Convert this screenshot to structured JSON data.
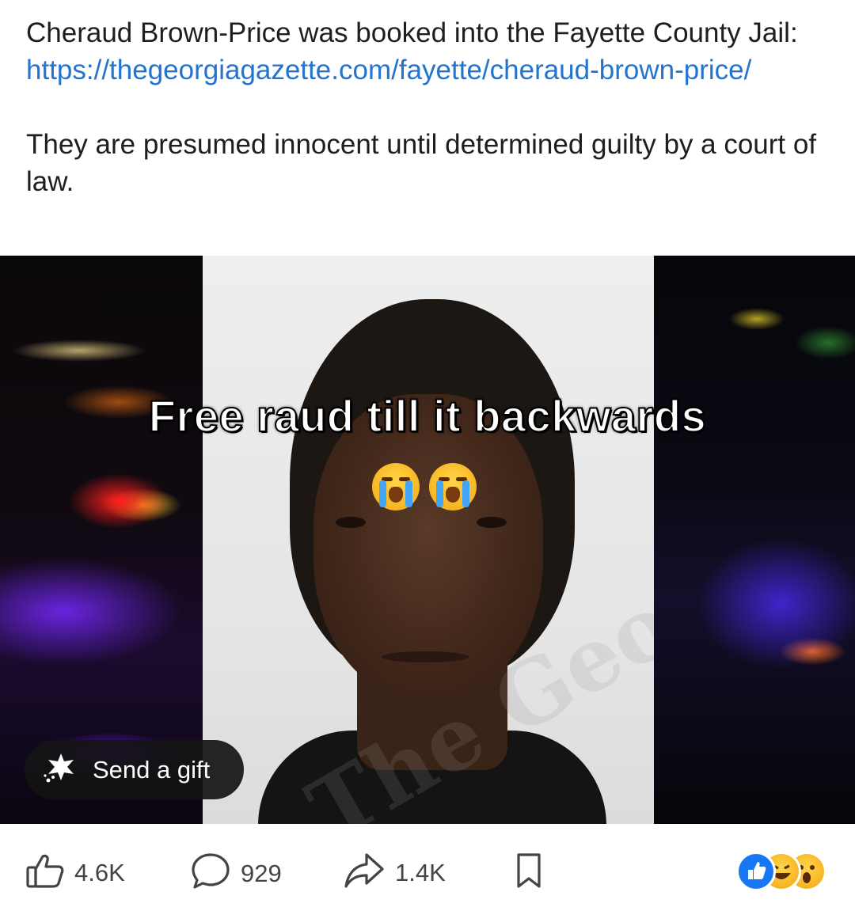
{
  "post": {
    "text_line1": "Cheraud Brown-Price was booked into the Fayette County Jail: ",
    "link": "https://thegeorgiagazette.com/fayette/cheraud-brown-price/",
    "text_line2": "They are presumed innocent until determined guilty by a court of law."
  },
  "media": {
    "overlay_caption": "Free raud till it backwards",
    "watermark": "The Georgia Gazette",
    "emoji": [
      "loudly-crying-face",
      "loudly-crying-face"
    ],
    "gift_button": {
      "label": "Send a gift",
      "icon": "gift-sparkle-icon"
    }
  },
  "actions": {
    "likes": "4.6K",
    "comments": "929",
    "shares": "1.4K",
    "save_icon": "bookmark-icon",
    "reactions": [
      "like",
      "haha",
      "wow"
    ]
  },
  "colors": {
    "link": "#2374d0",
    "text": "#1c1e21",
    "like_blue": "#1877f2"
  }
}
